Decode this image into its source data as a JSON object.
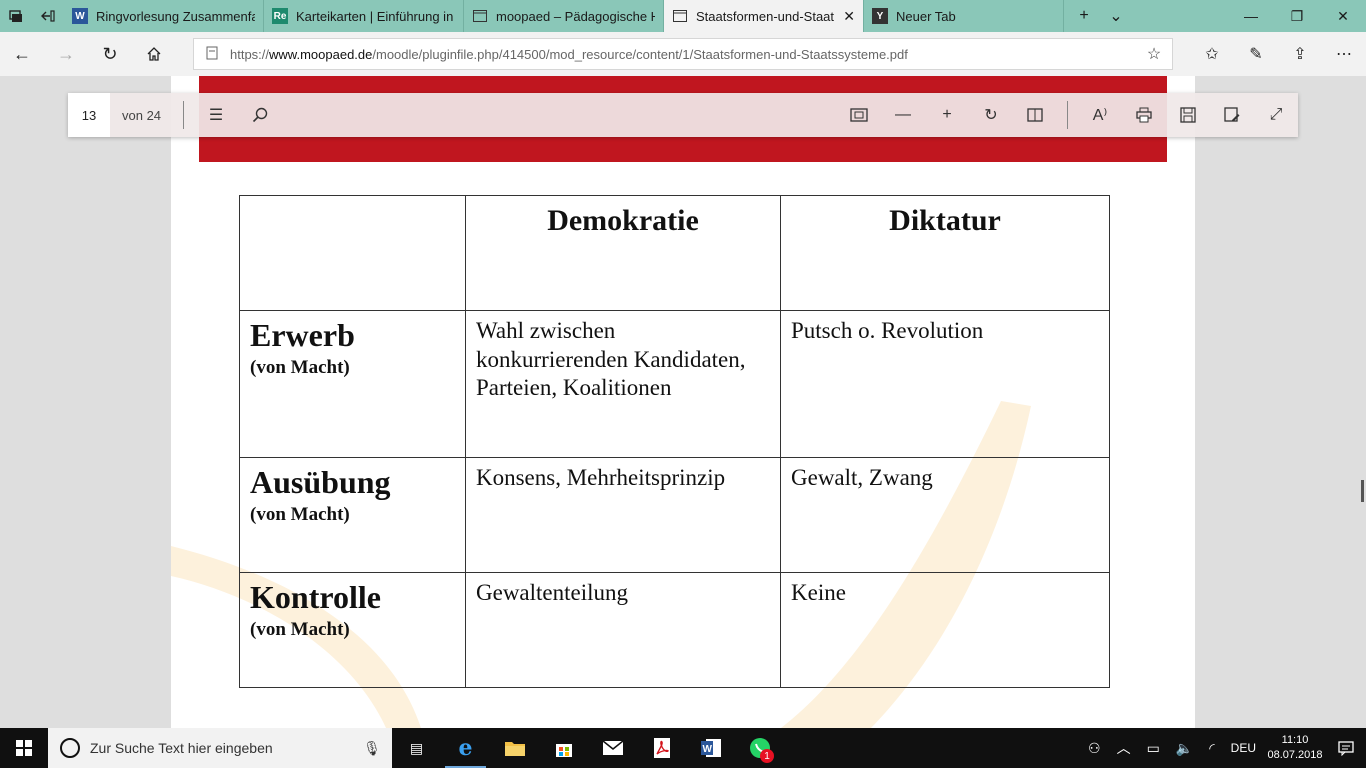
{
  "browser": {
    "tabs": [
      {
        "title": "Ringvorlesung Zusammenfa",
        "icon": "word-icon"
      },
      {
        "title": "Karteikarten | Einführung in",
        "icon": "repetico-icon"
      },
      {
        "title": "moopaed – Pädagogische H",
        "icon": "page-icon"
      },
      {
        "title": "Staatsformen-und-Staat",
        "icon": "page-icon",
        "active": true
      },
      {
        "title": "Neuer Tab",
        "icon": "y-icon"
      }
    ],
    "url_prefix": "https://",
    "url_domain": "www.moopaed.de",
    "url_path": "/moodle/pluginfile.php/414500/mod_resource/content/1/Staatsformen-und-Staatssysteme.pdf"
  },
  "pdf_toolbar": {
    "page": "13",
    "page_count": "von 24"
  },
  "document": {
    "headers": [
      "",
      "Demokratie",
      "Diktatur"
    ],
    "rows": [
      {
        "title": "Erwerb",
        "sub": "(von Macht)",
        "demokratie": "Wahl zwischen konkurrierenden Kandidaten, Parteien, Koalitionen",
        "diktatur": "Putsch o. Revolution"
      },
      {
        "title": "Ausübung",
        "sub": "(von Macht)",
        "demokratie": "Konsens, Mehrheitsprinzip",
        "diktatur": "Gewalt, Zwang"
      },
      {
        "title": "Kontrolle",
        "sub": "(von Macht)",
        "demokratie": "Gewaltenteilung",
        "diktatur": "Keine"
      }
    ],
    "accent_color": "#c0161f"
  },
  "taskbar": {
    "search_placeholder": "Zur Suche Text hier eingeben",
    "language": "DEU",
    "time": "11:10",
    "date": "08.07.2018",
    "whatsapp_badge": "1"
  }
}
